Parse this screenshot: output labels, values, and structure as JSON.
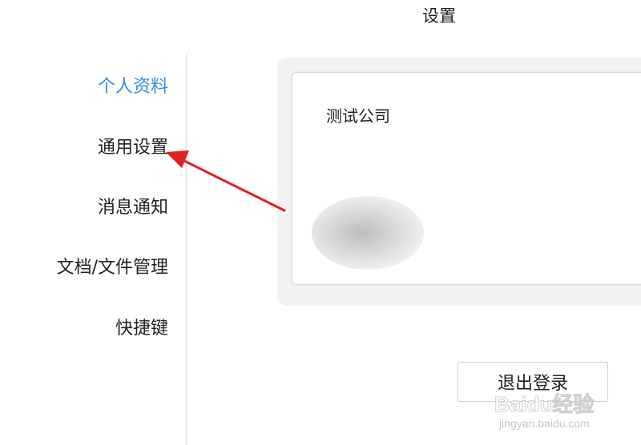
{
  "header": {
    "title": "设置"
  },
  "sidebar": {
    "items": [
      {
        "label": "个人资料",
        "active": true
      },
      {
        "label": "通用设置",
        "active": false
      },
      {
        "label": "消息通知",
        "active": false
      },
      {
        "label": "文档/文件管理",
        "active": false
      },
      {
        "label": "快捷键",
        "active": false
      }
    ]
  },
  "profile": {
    "company": "测试公司"
  },
  "actions": {
    "logout_label": "退出登录"
  },
  "watermark": {
    "brand": "Baidu经验",
    "url": "jingyan.baidu.com"
  },
  "colors": {
    "accent": "#2f8fe0",
    "annotation_arrow": "#e11f1f"
  }
}
